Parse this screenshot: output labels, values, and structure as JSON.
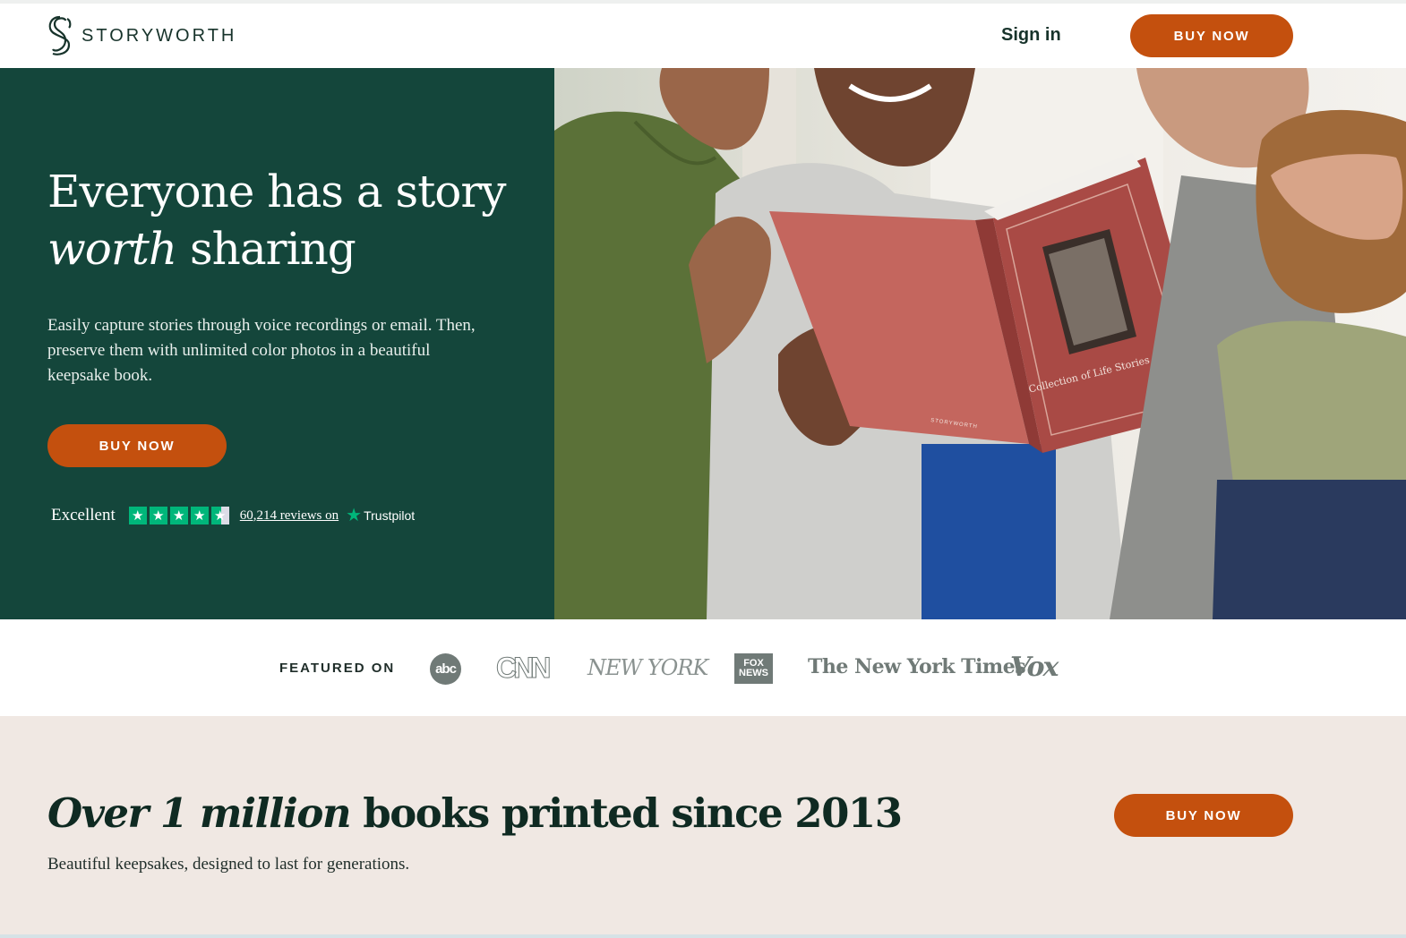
{
  "header": {
    "brand": "STORYWORTH",
    "sign_in": "Sign in",
    "buy_now": "BUY NOW"
  },
  "hero": {
    "title_line1": "Everyone has a story",
    "title_em": "worth",
    "title_rest": " sharing",
    "subtitle": "Easily capture stories through voice recordings or email. Then, preserve them with unlimited color photos in a beautiful keepsake book.",
    "buy_now": "BUY NOW",
    "trustpilot": {
      "rating_word": "Excellent",
      "stars": 4.5,
      "reviews": "60,214 reviews on",
      "brand": "Trustpilot"
    },
    "book": {
      "title": "Collection of Life Stories",
      "brand": "STORYWORTH"
    }
  },
  "featured": {
    "label": "FEATURED ON",
    "logos": {
      "abc": "abc",
      "cnn": "CNN",
      "nymag": "NEW YORK",
      "fox_1": "FOX",
      "fox_2": "NEWS",
      "nyt": "The New York Times",
      "vox": "Vox"
    }
  },
  "stats": {
    "title_em": "Over 1 million",
    "title_rest": " books printed since 2013",
    "subtitle": "Beautiful keepsakes, designed to last for generations.",
    "buy_now": "BUY NOW"
  },
  "colors": {
    "hero_green": "#14463b",
    "cta_orange": "#c4500e",
    "stats_bg": "#f0e8e3",
    "trustpilot_green": "#00b67a"
  }
}
